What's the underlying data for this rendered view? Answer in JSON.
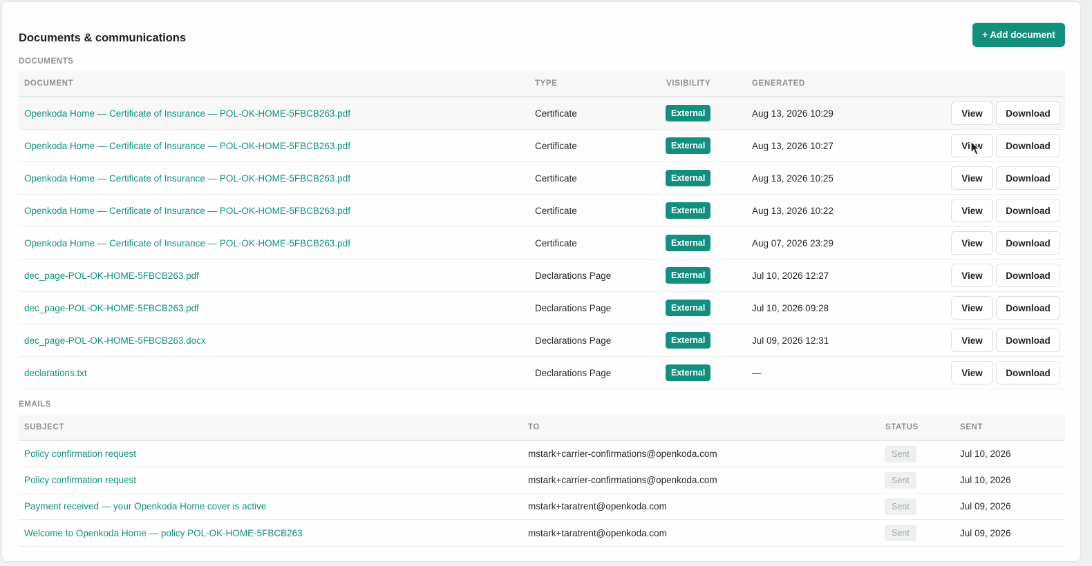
{
  "header": {
    "title": "Documents & communications",
    "add_button": "+ Add document"
  },
  "documents": {
    "section_label": "DOCUMENTS",
    "columns": [
      "DOCUMENT",
      "TYPE",
      "VISIBILITY",
      "GENERATED"
    ],
    "view_label": "View",
    "download_label": "Download",
    "rows": [
      {
        "name": "Openkoda Home — Certificate of Insurance — POL-OK-HOME-5FBCB263.pdf",
        "type": "Certificate",
        "visibility": "External",
        "generated": "Aug 13, 2026 10:29"
      },
      {
        "name": "Openkoda Home — Certificate of Insurance — POL-OK-HOME-5FBCB263.pdf",
        "type": "Certificate",
        "visibility": "External",
        "generated": "Aug 13, 2026 10:27"
      },
      {
        "name": "Openkoda Home — Certificate of Insurance — POL-OK-HOME-5FBCB263.pdf",
        "type": "Certificate",
        "visibility": "External",
        "generated": "Aug 13, 2026 10:25"
      },
      {
        "name": "Openkoda Home — Certificate of Insurance — POL-OK-HOME-5FBCB263.pdf",
        "type": "Certificate",
        "visibility": "External",
        "generated": "Aug 13, 2026 10:22"
      },
      {
        "name": "Openkoda Home — Certificate of Insurance — POL-OK-HOME-5FBCB263.pdf",
        "type": "Certificate",
        "visibility": "External",
        "generated": "Aug 07, 2026 23:29"
      },
      {
        "name": "dec_page-POL-OK-HOME-5FBCB263.pdf",
        "type": "Declarations Page",
        "visibility": "External",
        "generated": "Jul 10, 2026 12:27"
      },
      {
        "name": "dec_page-POL-OK-HOME-5FBCB263.pdf",
        "type": "Declarations Page",
        "visibility": "External",
        "generated": "Jul 10, 2026 09:28"
      },
      {
        "name": "dec_page-POL-OK-HOME-5FBCB263.docx",
        "type": "Declarations Page",
        "visibility": "External",
        "generated": "Jul 09, 2026 12:31"
      },
      {
        "name": "declarations.txt",
        "type": "Declarations Page",
        "visibility": "External",
        "generated": "—"
      }
    ]
  },
  "emails": {
    "section_label": "EMAILS",
    "columns": [
      "SUBJECT",
      "TO",
      "STATUS",
      "SENT"
    ],
    "rows": [
      {
        "subject": "Policy confirmation request",
        "to": "mstark+carrier-confirmations@openkoda.com",
        "status": "Sent",
        "sent": "Jul 10, 2026"
      },
      {
        "subject": "Policy confirmation request",
        "to": "mstark+carrier-confirmations@openkoda.com",
        "status": "Sent",
        "sent": "Jul 10, 2026"
      },
      {
        "subject": "Payment received — your Openkoda Home cover is active",
        "to": "mstark+taratrent@openkoda.com",
        "status": "Sent",
        "sent": "Jul 09, 2026"
      },
      {
        "subject": "Welcome to Openkoda Home — policy POL-OK-HOME-5FBCB263",
        "to": "mstark+taratrent@openkoda.com",
        "status": "Sent",
        "sent": "Jul 09, 2026"
      }
    ]
  },
  "colors": {
    "accent": "#13907d",
    "muted": "#8c9196"
  },
  "icons": {
    "cursor": "pointer-cursor-icon"
  }
}
